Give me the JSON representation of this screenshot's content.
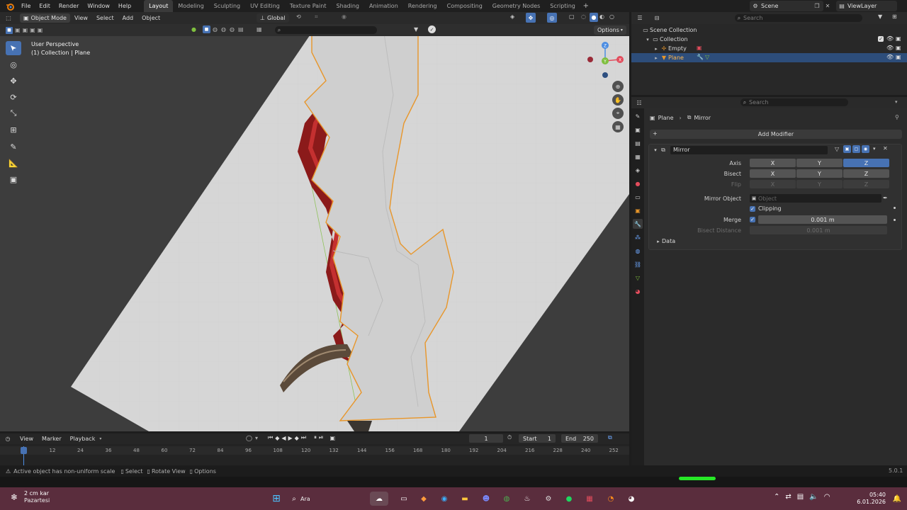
{
  "menu": {
    "file": "File",
    "edit": "Edit",
    "render": "Render",
    "window": "Window",
    "help": "Help"
  },
  "workspaces": [
    "Layout",
    "Modeling",
    "Sculpting",
    "UV Editing",
    "Texture Paint",
    "Shading",
    "Animation",
    "Rendering",
    "Compositing",
    "Geometry Nodes",
    "Scripting"
  ],
  "active_workspace": "Layout",
  "scene": {
    "label": "Scene",
    "view_layer": "ViewLayer",
    "search_placeholder": "Search"
  },
  "viewport_header": {
    "mode": "Object Mode",
    "view": "View",
    "select": "Select",
    "add": "Add",
    "object": "Object",
    "orientation": "Global",
    "options": "Options"
  },
  "viewport": {
    "perspective": "User Perspective",
    "collection": "(1) Collection | Plane"
  },
  "outliner": {
    "search_placeholder": "Search",
    "scene_collection": "Scene Collection",
    "collection": "Collection",
    "items": [
      {
        "name": "Empty"
      },
      {
        "name": "Plane"
      }
    ]
  },
  "properties": {
    "search_placeholder": "Search",
    "breadcrumb_object": "Plane",
    "breadcrumb_modifier": "Mirror",
    "add_modifier": "Add Modifier",
    "modifier_name": "Mirror",
    "axis_label": "Axis",
    "bisect_label": "Bisect",
    "flip_label": "Flip",
    "axes": [
      "X",
      "Y",
      "Z"
    ],
    "mirror_object_label": "Mirror Object",
    "mirror_object_placeholder": "Object",
    "clipping_label": "Clipping",
    "merge_label": "Merge",
    "merge_value": "0.001 m",
    "bisect_distance_label": "Bisect Distance",
    "bisect_distance_value": "0.001 m",
    "data_label": "Data"
  },
  "timeline": {
    "view": "View",
    "marker": "Marker",
    "playback": "Playback",
    "current_frame": "1",
    "start_label": "Start",
    "start_value": "1",
    "end_label": "End",
    "end_value": "250",
    "ticks": [
      "1",
      "12",
      "24",
      "36",
      "48",
      "60",
      "72",
      "84",
      "96",
      "108",
      "120",
      "132",
      "144",
      "156",
      "168",
      "180",
      "192",
      "204",
      "216",
      "228",
      "240",
      "252"
    ]
  },
  "statusbar": {
    "message": "Active object has non-uniform scale",
    "select": "Select",
    "rotate_view": "Rotate View",
    "options": "Options",
    "version": "5.0.1"
  },
  "taskbar": {
    "weather_temp": "2 cm kar",
    "weather_day": "Pazartesi",
    "search": "Ara",
    "time": "05:40",
    "date": "6.01.2026"
  },
  "colors": {
    "accent": "#4772b3",
    "axis_x": "#e24c5c",
    "axis_y": "#7fbf3f",
    "axis_z": "#4c8de2",
    "taskbar": "#5a2d3d"
  }
}
